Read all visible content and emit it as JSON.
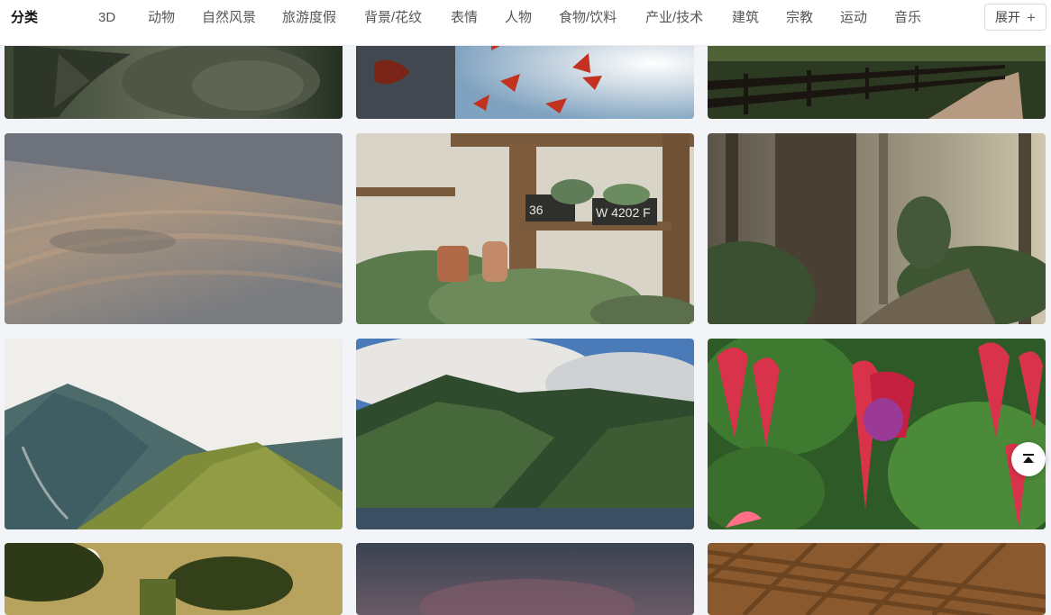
{
  "category": {
    "label": "分类"
  },
  "nav": {
    "items": [
      {
        "label": "3D"
      },
      {
        "label": "动物"
      },
      {
        "label": "自然风景"
      },
      {
        "label": "旅游度假"
      },
      {
        "label": "背景/花纹"
      },
      {
        "label": "表情"
      },
      {
        "label": "人物"
      },
      {
        "label": "食物/饮料"
      },
      {
        "label": "产业/技术"
      },
      {
        "label": "建筑"
      },
      {
        "label": "宗教"
      },
      {
        "label": "运动"
      },
      {
        "label": "音乐"
      }
    ],
    "expand_label": "展开",
    "expand_icon": "plus-icon"
  },
  "gallery": {
    "photos": [
      {
        "subject": "fish"
      },
      {
        "subject": "red-leaves-sunlight"
      },
      {
        "subject": "fence-path"
      },
      {
        "subject": "sand-dune"
      },
      {
        "subject": "potted-plants-shelf",
        "sign_left": "36",
        "sign_right": "W 4202 F"
      },
      {
        "subject": "forest-tree"
      },
      {
        "subject": "mountain-clouds"
      },
      {
        "subject": "green-mountains-coast"
      },
      {
        "subject": "fuchsia-flowers"
      },
      {
        "subject": "sunset-trees"
      },
      {
        "subject": "dusk-sky"
      },
      {
        "subject": "woven-texture"
      }
    ]
  },
  "scroll_top": {
    "icon": "arrow-to-top-icon"
  }
}
